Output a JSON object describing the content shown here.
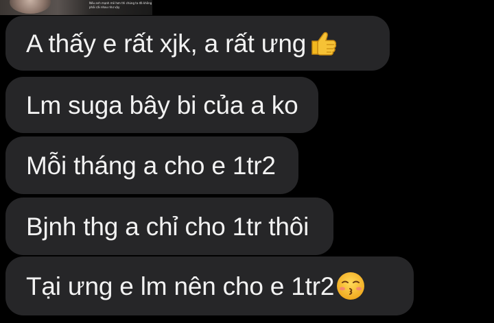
{
  "header_image": {
    "caption_lines": [
      "Nếu anh mạnh mẽ hơn thì chúng ta đã không",
      "phải cãi nhau như vậy"
    ]
  },
  "messages": [
    {
      "text": "A thấy e rất xjk, a rất ưng",
      "emoji": "thumbs-up-icon"
    },
    {
      "text": "Lm suga bây bi của a ko"
    },
    {
      "text": "Mỗi tháng a cho e 1tr2"
    },
    {
      "text": "Bjnh thg a chỉ cho 1tr thôi"
    },
    {
      "text": "Tại ưng e lm nên cho e 1tr2",
      "emoji": "kissing-face-icon"
    }
  ],
  "colors": {
    "background": "#000000",
    "bubble": "#262628",
    "text": "#f2f2f2",
    "emoji_yellow": "#f6c236"
  }
}
